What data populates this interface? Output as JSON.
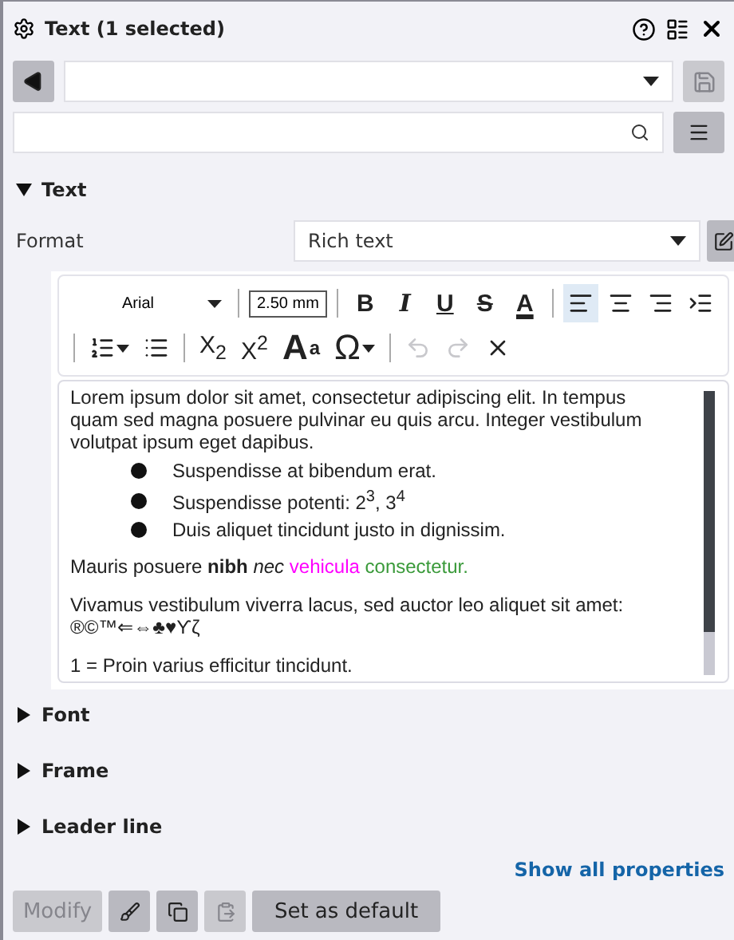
{
  "panel": {
    "title": "Text (1 selected)"
  },
  "save_button": {
    "disabled": true
  },
  "sections": [
    {
      "label": "Text",
      "expanded": true
    },
    {
      "label": "Font",
      "expanded": false
    },
    {
      "label": "Frame",
      "expanded": false
    },
    {
      "label": "Leader line",
      "expanded": false
    }
  ],
  "format": {
    "label": "Format",
    "value": "Rich text"
  },
  "toolbar": {
    "font": "Arial",
    "size": "2.50 mm",
    "row_1": [
      {
        "kind": "bold",
        "label": "B",
        "selected": false
      },
      {
        "kind": "italic",
        "label": "I",
        "selected": false
      },
      {
        "kind": "underline",
        "label": "U",
        "selected": false
      },
      {
        "kind": "strike",
        "label": "S",
        "selected": false
      },
      {
        "kind": "color",
        "label": "A",
        "selected": false
      },
      {
        "kind": "sep"
      },
      {
        "kind": "align-left",
        "selected": true
      },
      {
        "kind": "align-center",
        "selected": false
      },
      {
        "kind": "align-right",
        "selected": false
      },
      {
        "kind": "indent",
        "selected": false
      }
    ],
    "row_2": [
      {
        "kind": "numbered",
        "disabled": false
      },
      {
        "kind": "bullets",
        "disabled": false
      },
      {
        "kind": "sep"
      },
      {
        "kind": "text",
        "label": "X$_{2}$",
        "disabled": false
      },
      {
        "kind": "text",
        "label": "X$^{2}$",
        "disabled": false
      },
      {
        "kind": "fontsize",
        "label": "A",
        "small": "a",
        "disabled": false
      },
      {
        "kind": "symbol",
        "label": "Ω",
        "disabled": false
      },
      {
        "kind": "sep"
      },
      {
        "kind": "undo",
        "disabled": true
      },
      {
        "kind": "redo",
        "disabled": true
      },
      {
        "kind": "clear",
        "disabled": false
      }
    ]
  },
  "content": [
    {
      "kind": "para",
      "runs": [
        {
          "text": "Lorem ipsum dolor sit amet, consectetur adipiscing elit. In tempus quam sed magna posuere pulvinar eu quis arcu. Integer vestibulum volutpat ipsum eget dapibus."
        }
      ]
    },
    {
      "kind": "bullet",
      "text": "Suspendisse at bibendum erat."
    },
    {
      "kind": "bullet",
      "text": "Suspendisse potenti: 2$^{3}$, 3$^{4}$"
    },
    {
      "kind": "bullet",
      "text": "Duis aliquet tincidunt justo in dignissim."
    },
    {
      "kind": "para",
      "runs": [
        {
          "text": "Mauris posuere "
        },
        {
          "text": "nibh",
          "kind": "bold"
        },
        {
          "text": " nec",
          "kind": "italic"
        },
        {
          "text": " vehicula",
          "color": "#ff00ff"
        },
        {
          "text": " consectetur.",
          "color": "#3a9a3a"
        }
      ]
    },
    {
      "kind": "para",
      "runs": [
        {
          "text": "Vivamus vestibulum viverra lacus, sed auctor leo aliquet sit amet: ®©™⇐⇔♣♥ϒζ"
        }
      ]
    },
    {
      "kind": "para",
      "runs": [
        {
          "text": "1 = Proin varius efficitur tincidunt."
        }
      ]
    }
  ],
  "link": "Show all properties",
  "footer": [
    {
      "kind": "text",
      "label": "Modify",
      "disabled": true
    },
    {
      "kind": "brush",
      "disabled": false
    },
    {
      "kind": "copy",
      "disabled": false
    },
    {
      "kind": "paste",
      "disabled": true
    },
    {
      "kind": "text",
      "label": "Set as default",
      "disabled": false
    }
  ]
}
